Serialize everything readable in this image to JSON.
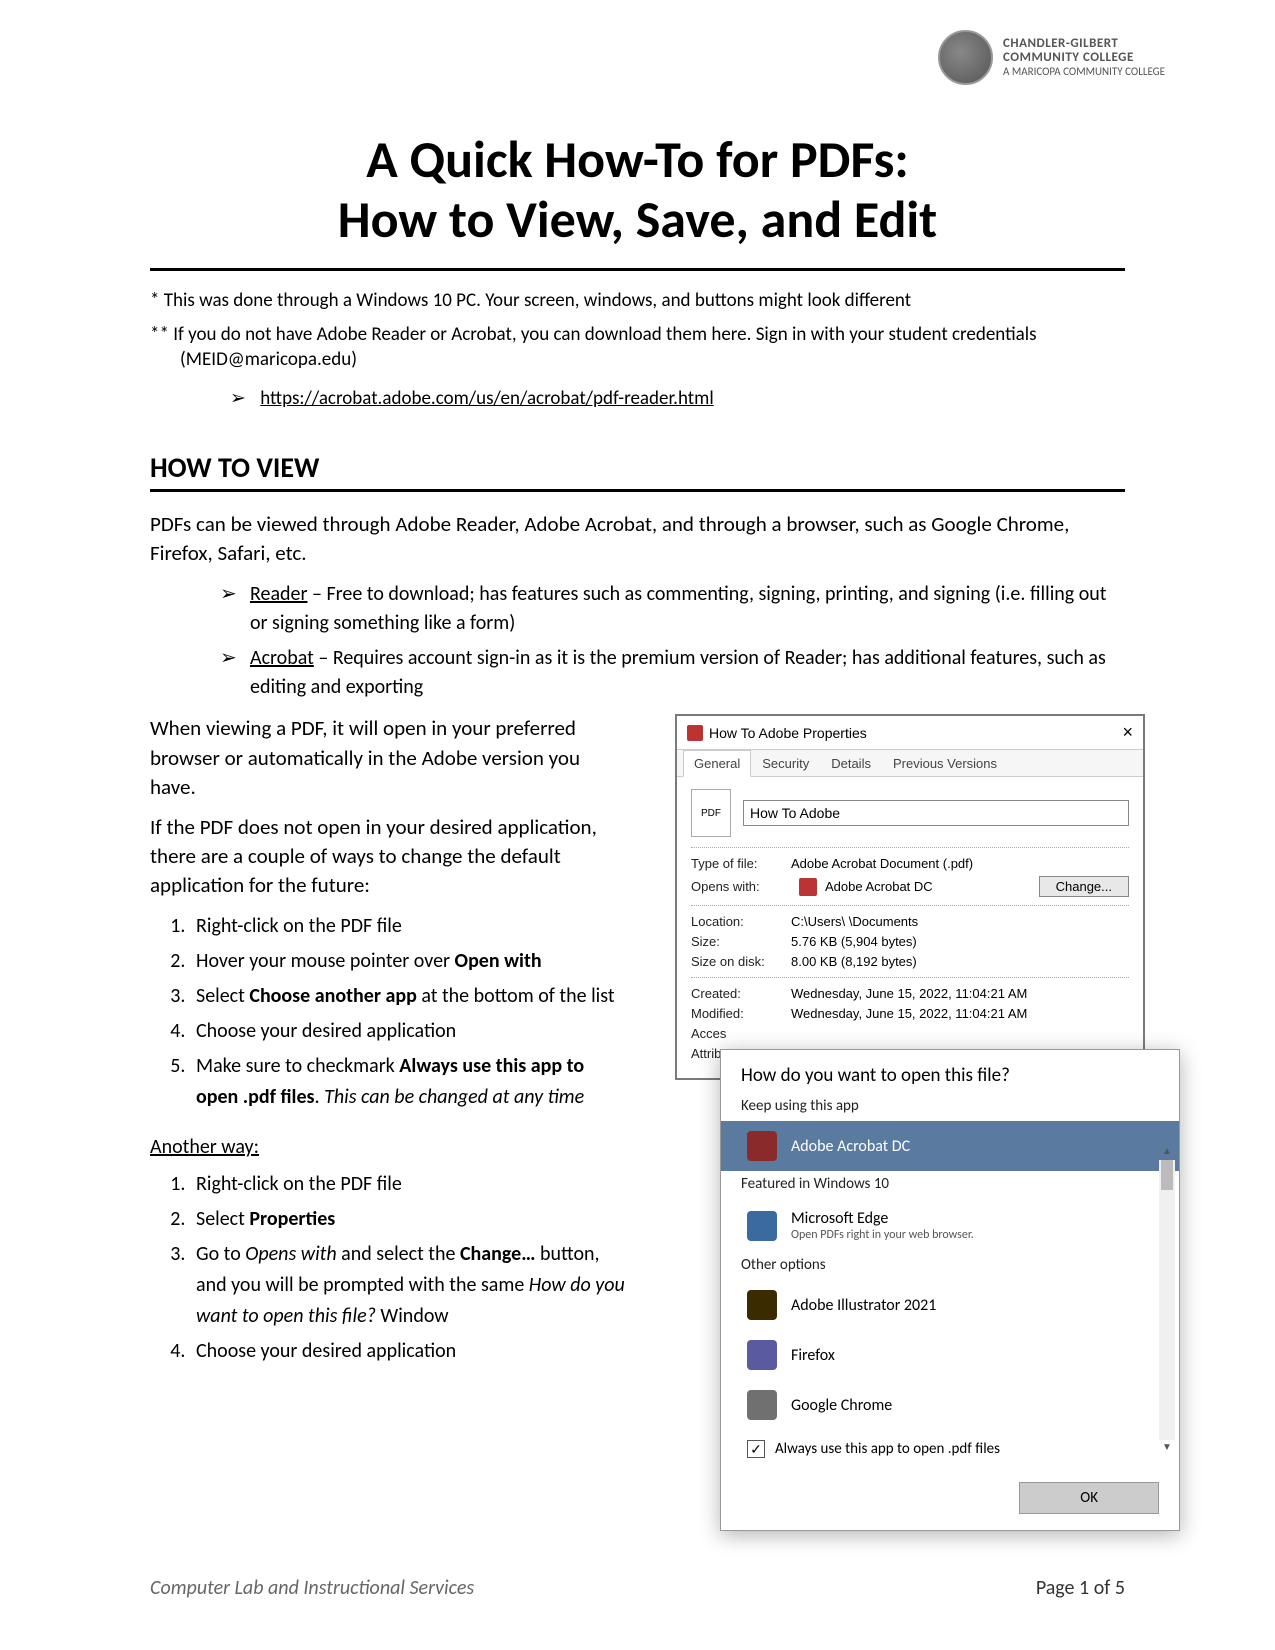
{
  "header": {
    "org_line1": "CHANDLER-GILBERT",
    "org_line2": "COMMUNITY COLLEGE",
    "org_line3": "A MARICOPA COMMUNITY COLLEGE"
  },
  "title": {
    "line1": "A Quick How-To for PDFs:",
    "line2": "How to View, Save, and Edit"
  },
  "notes": {
    "n1": "* This was done through a Windows 10 PC. Your screen, windows, and buttons might look different",
    "n2a": "** If you do not have Adobe Reader or Acrobat, you can download them here. Sign in with your student credentials",
    "n2b": "(MEID@maricopa.edu)",
    "link": "https://acrobat.adobe.com/us/en/acrobat/pdf-reader.html"
  },
  "section_view": {
    "heading": "HOW TO VIEW",
    "intro": "PDFs can be viewed through Adobe Reader, Adobe Acrobat, and through a browser, such as Google Chrome, Firefox, Safari, etc.",
    "reader_label": "Reader",
    "reader_text": " – Free to download; has features such as commenting, signing, printing, and signing (i.e. filling out or signing something like a form)",
    "acrobat_label": "Acrobat",
    "acrobat_text": " – Requires account sign-in as it is the premium version of Reader; has additional features, such as editing and exporting",
    "p2": "When viewing a PDF, it will open in your preferred browser or automatically in the Adobe version you have.",
    "p3": "If the PDF does not open in your desired application, there are a couple of ways to change the default application for the future:",
    "steps": [
      "Right-click on the PDF file",
      "Hover your mouse pointer over Open with",
      "Select Choose another app at the bottom of the list",
      "Choose your desired application",
      "Make sure to checkmark Always use this app to open .pdf files. This can be changed at any time"
    ],
    "another_way": "Another way:",
    "steps2": [
      "Right-click on the PDF file",
      "Select Properties",
      "Go to Opens with and select the Change… button, and you will be prompted with the same How do you want to open this file? Window",
      "Choose your desired application"
    ]
  },
  "props": {
    "title": "How To Adobe Properties",
    "tabs": [
      "General",
      "Security",
      "Details",
      "Previous Versions"
    ],
    "filename": "How To Adobe",
    "type_of_file_lbl": "Type of file:",
    "type_of_file_val": "Adobe Acrobat Document (.pdf)",
    "opens_with_lbl": "Opens with:",
    "opens_with_val": "Adobe Acrobat DC",
    "change_btn": "Change...",
    "location_lbl": "Location:",
    "location_val": "C:\\Users\\            \\Documents",
    "size_lbl": "Size:",
    "size_val": "5.76 KB (5,904 bytes)",
    "size_on_disk_lbl": "Size on disk:",
    "size_on_disk_val": "8.00 KB (8,192 bytes)",
    "created_lbl": "Created:",
    "created_val": "Wednesday, June 15, 2022, 11:04:21 AM",
    "modified_lbl": "Modified:",
    "modified_val": "Wednesday, June 15, 2022, 11:04:21 AM",
    "accessed_lbl": "Acces",
    "attrib_lbl": "Attribu"
  },
  "openwith": {
    "head": "How do you want to open this file?",
    "keep": "Keep using this app",
    "item_acrobat": "Adobe Acrobat DC",
    "featured": "Featured in Windows 10",
    "item_edge": "Microsoft Edge",
    "item_edge_sub": "Open PDFs right in your web browser.",
    "other": "Other options",
    "item_ai": "Adobe Illustrator 2021",
    "item_ff": "Firefox",
    "item_gc": "Google Chrome",
    "always": "Always use this app to open .pdf files",
    "ok": "OK"
  },
  "footer": {
    "left": "Computer Lab and Instructional Services",
    "right": "Page 1 of 5"
  }
}
